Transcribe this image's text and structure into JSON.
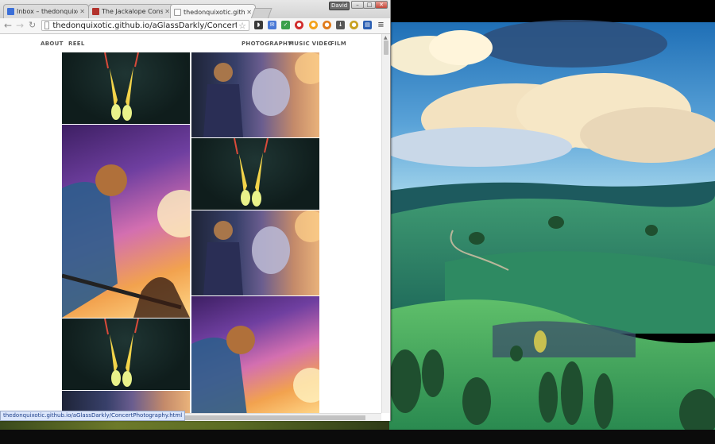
{
  "browser": {
    "tabs": [
      {
        "label": "Inbox – thedonquixotic@…",
        "favicon": "gmail-icon",
        "active": false
      },
      {
        "label": "The Jackalope Conspiracy",
        "favicon": "blog-icon",
        "active": false
      },
      {
        "label": "thedonquixotic.github.io/",
        "favicon": "page-icon",
        "active": true
      }
    ],
    "user_badge": "David",
    "url": "thedonquixotic.github.io/aGlassDarkly/ConcertPhotography.html",
    "extensions": [
      "pocket-icon",
      "mail-icon",
      "evernote-icon",
      "adblock-icon",
      "honey-icon",
      "pumpkin-icon",
      "download-icon",
      "bee-icon",
      "reader-icon",
      "menu-icon"
    ],
    "status_text": "thedonquixotic.github.io/aGlassDarkly/ConcertPhotography.html"
  },
  "site": {
    "nav_left": [
      "ABOUT",
      "REEL"
    ],
    "nav_right": [
      "PHOTOGRAPHY",
      "MUSIC VIDEO",
      "FILM"
    ]
  },
  "photos": [
    {
      "subject": "stage-lights"
    },
    {
      "subject": "drummer"
    },
    {
      "subject": "guitarist"
    },
    {
      "subject": "stage-lights"
    },
    {
      "subject": "drummer"
    },
    {
      "subject": "stage-lights"
    },
    {
      "subject": "guitarist"
    },
    {
      "subject": "stage-lights"
    }
  ],
  "colors": {
    "accent": "#4a79d6",
    "chrome": "#d3d3d3"
  }
}
